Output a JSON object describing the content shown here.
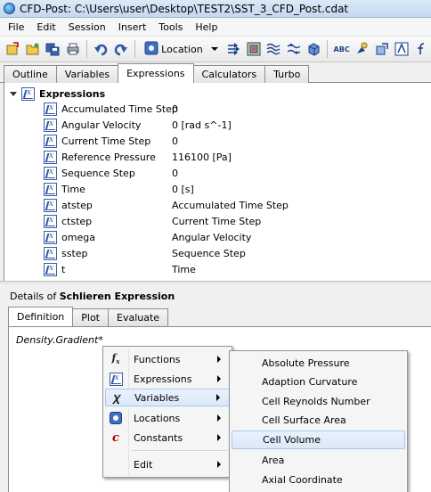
{
  "window": {
    "title": "CFD-Post: C:\\Users\\user\\Desktop\\TEST2\\SST_3_CFD_Post.cdat"
  },
  "menubar": [
    "File",
    "Edit",
    "Session",
    "Insert",
    "Tools",
    "Help"
  ],
  "toolbar": {
    "location_label": "Location",
    "icons": [
      "new-icon",
      "open-icon",
      "save-icon",
      "print-icon",
      "undo-icon",
      "redo-icon",
      "location-icon",
      "vector-icon",
      "contour-icon",
      "streamline-icon",
      "volume-icon",
      "text-icon",
      "probe-icon",
      "transform-icon",
      "expression-icon"
    ]
  },
  "tabs_top": [
    "Outline",
    "Variables",
    "Expressions",
    "Calculators",
    "Turbo"
  ],
  "tree": {
    "root": "Expressions",
    "rows": [
      {
        "name": "Accumulated Time Step",
        "value": "0"
      },
      {
        "name": "Angular Velocity",
        "value": "0 [rad s^-1]"
      },
      {
        "name": "Current Time Step",
        "value": "0"
      },
      {
        "name": "Reference Pressure",
        "value": "116100 [Pa]"
      },
      {
        "name": "Sequence Step",
        "value": "0"
      },
      {
        "name": "Time",
        "value": "0 [s]"
      },
      {
        "name": "atstep",
        "value": "Accumulated Time Step"
      },
      {
        "name": "ctstep",
        "value": "Current Time Step"
      },
      {
        "name": "omega",
        "value": "Angular Velocity"
      },
      {
        "name": "sstep",
        "value": "Sequence Step"
      },
      {
        "name": "t",
        "value": "Time"
      }
    ]
  },
  "details": {
    "prefix": "Details of ",
    "name": "Schlieren Expression",
    "tabs": [
      "Definition",
      "Plot",
      "Evaluate"
    ],
    "definition_text": "Density.Gradient*"
  },
  "context_menu": {
    "items": [
      {
        "label": "Functions",
        "icon": "functions-icon"
      },
      {
        "label": "Expressions",
        "icon": "expression-icon"
      },
      {
        "label": "Variables",
        "icon": "variables-icon"
      },
      {
        "label": "Locations",
        "icon": "locations-icon"
      },
      {
        "label": "Constants",
        "icon": "constants-icon"
      },
      {
        "label": "Edit",
        "icon": ""
      }
    ]
  },
  "submenu": {
    "items": [
      "Absolute Pressure",
      "Adaption Curvature",
      "Cell Reynolds Number",
      "Cell Surface Area",
      "Cell Volume",
      "Area",
      "Axial Coordinate"
    ]
  },
  "colors": {
    "accent": "#2d56a8",
    "highlight": "#dbe8f8"
  }
}
